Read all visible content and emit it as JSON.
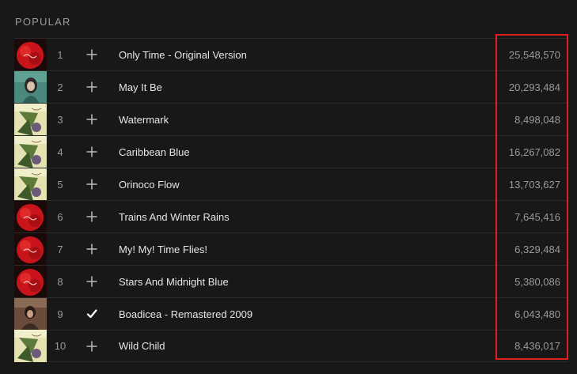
{
  "section": {
    "title": "POPULAR"
  },
  "colors": {
    "background": "#181818",
    "highlight": "#e0201c"
  },
  "tracks": [
    {
      "number": "1",
      "title": "Only Time - Original Version",
      "plays": "25,548,570",
      "added": false,
      "cover": "red-album"
    },
    {
      "number": "2",
      "title": "May It Be",
      "plays": "20,293,484",
      "added": false,
      "cover": "teal-album"
    },
    {
      "number": "3",
      "title": "Watermark",
      "plays": "8,498,048",
      "added": false,
      "cover": "green-album"
    },
    {
      "number": "4",
      "title": "Caribbean Blue",
      "plays": "16,267,082",
      "added": false,
      "cover": "green-album"
    },
    {
      "number": "5",
      "title": "Orinoco Flow",
      "plays": "13,703,627",
      "added": false,
      "cover": "green-album"
    },
    {
      "number": "6",
      "title": "Trains And Winter Rains",
      "plays": "7,645,416",
      "added": false,
      "cover": "red-album"
    },
    {
      "number": "7",
      "title": "My! My! Time Flies!",
      "plays": "6,329,484",
      "added": false,
      "cover": "red-album"
    },
    {
      "number": "8",
      "title": "Stars And Midnight Blue",
      "plays": "5,380,086",
      "added": false,
      "cover": "red-album"
    },
    {
      "number": "9",
      "title": "Boadicea - Remastered 2009",
      "plays": "6,043,480",
      "added": true,
      "cover": "brown-album"
    },
    {
      "number": "10",
      "title": "Wild Child",
      "plays": "8,436,017",
      "added": false,
      "cover": "green-album"
    }
  ]
}
